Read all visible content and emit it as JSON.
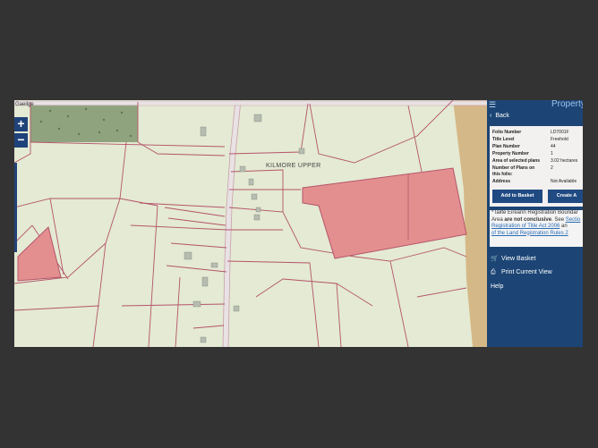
{
  "map": {
    "language_link": "Gaeilge",
    "zoom_in_label": "+",
    "zoom_out_label": "−",
    "townland_label": "KILMORE UPPER",
    "colors": {
      "parcel_fill": "#dfe7cf",
      "boundary": "#b4546a",
      "selected_fill": "#e48f8f"
    }
  },
  "panel": {
    "title": "Property",
    "back_label": "Back",
    "fields": [
      {
        "key": "Folio Number",
        "value": "LD7001F"
      },
      {
        "key": "Title Level",
        "value": "Freehold"
      },
      {
        "key": "Plan Number",
        "value": "44"
      },
      {
        "key": "Property Number",
        "value": "1"
      },
      {
        "key": "Area of selected plans",
        "value": "3.02 hectares"
      },
      {
        "key": "Number of Plans on",
        "value": "2"
      },
      {
        "key": "this folio:",
        "value": ""
      },
      {
        "key": "Address",
        "value": "Not Available"
      }
    ],
    "add_to_basket_label": "Add to Basket",
    "create_label": "Create A",
    "note_lines": [
      "*Tailte Éireann Registration Boundar",
      "Area ",
      "are not conclusive",
      ". See ",
      "Sectio",
      "Registration of Title Act 2006",
      " an",
      "of the Land Registration Rules 2"
    ],
    "menu": {
      "view_basket": "View Basket",
      "print_view": "Print Current View",
      "help": "Help"
    }
  }
}
